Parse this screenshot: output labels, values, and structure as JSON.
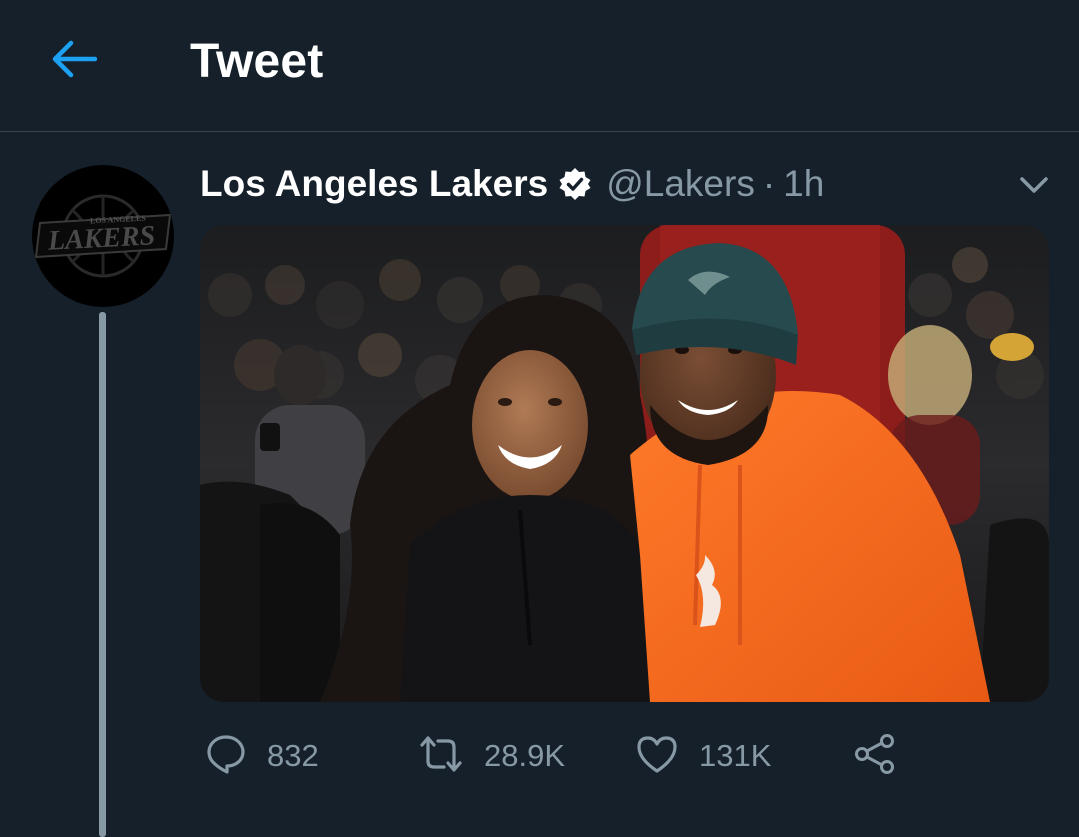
{
  "header": {
    "title": "Tweet",
    "back_icon": "arrow-left-icon",
    "accent_color": "#1da1f2"
  },
  "tweet": {
    "display_name": "Los Angeles Lakers",
    "verified": true,
    "handle": "@Lakers",
    "separator": "·",
    "time": "1h",
    "avatar_logo": {
      "top_text": "LOS ANGELES",
      "main_text": "LAKERS"
    },
    "media_description_hidden": true
  },
  "actions": {
    "reply_count": "832",
    "retweet_count": "28.9K",
    "like_count": "131K",
    "icons": [
      "reply-icon",
      "retweet-icon",
      "like-icon",
      "share-icon"
    ]
  },
  "colors": {
    "background": "#15202b",
    "secondary_text": "#8899a6",
    "divider": "#38444d"
  }
}
